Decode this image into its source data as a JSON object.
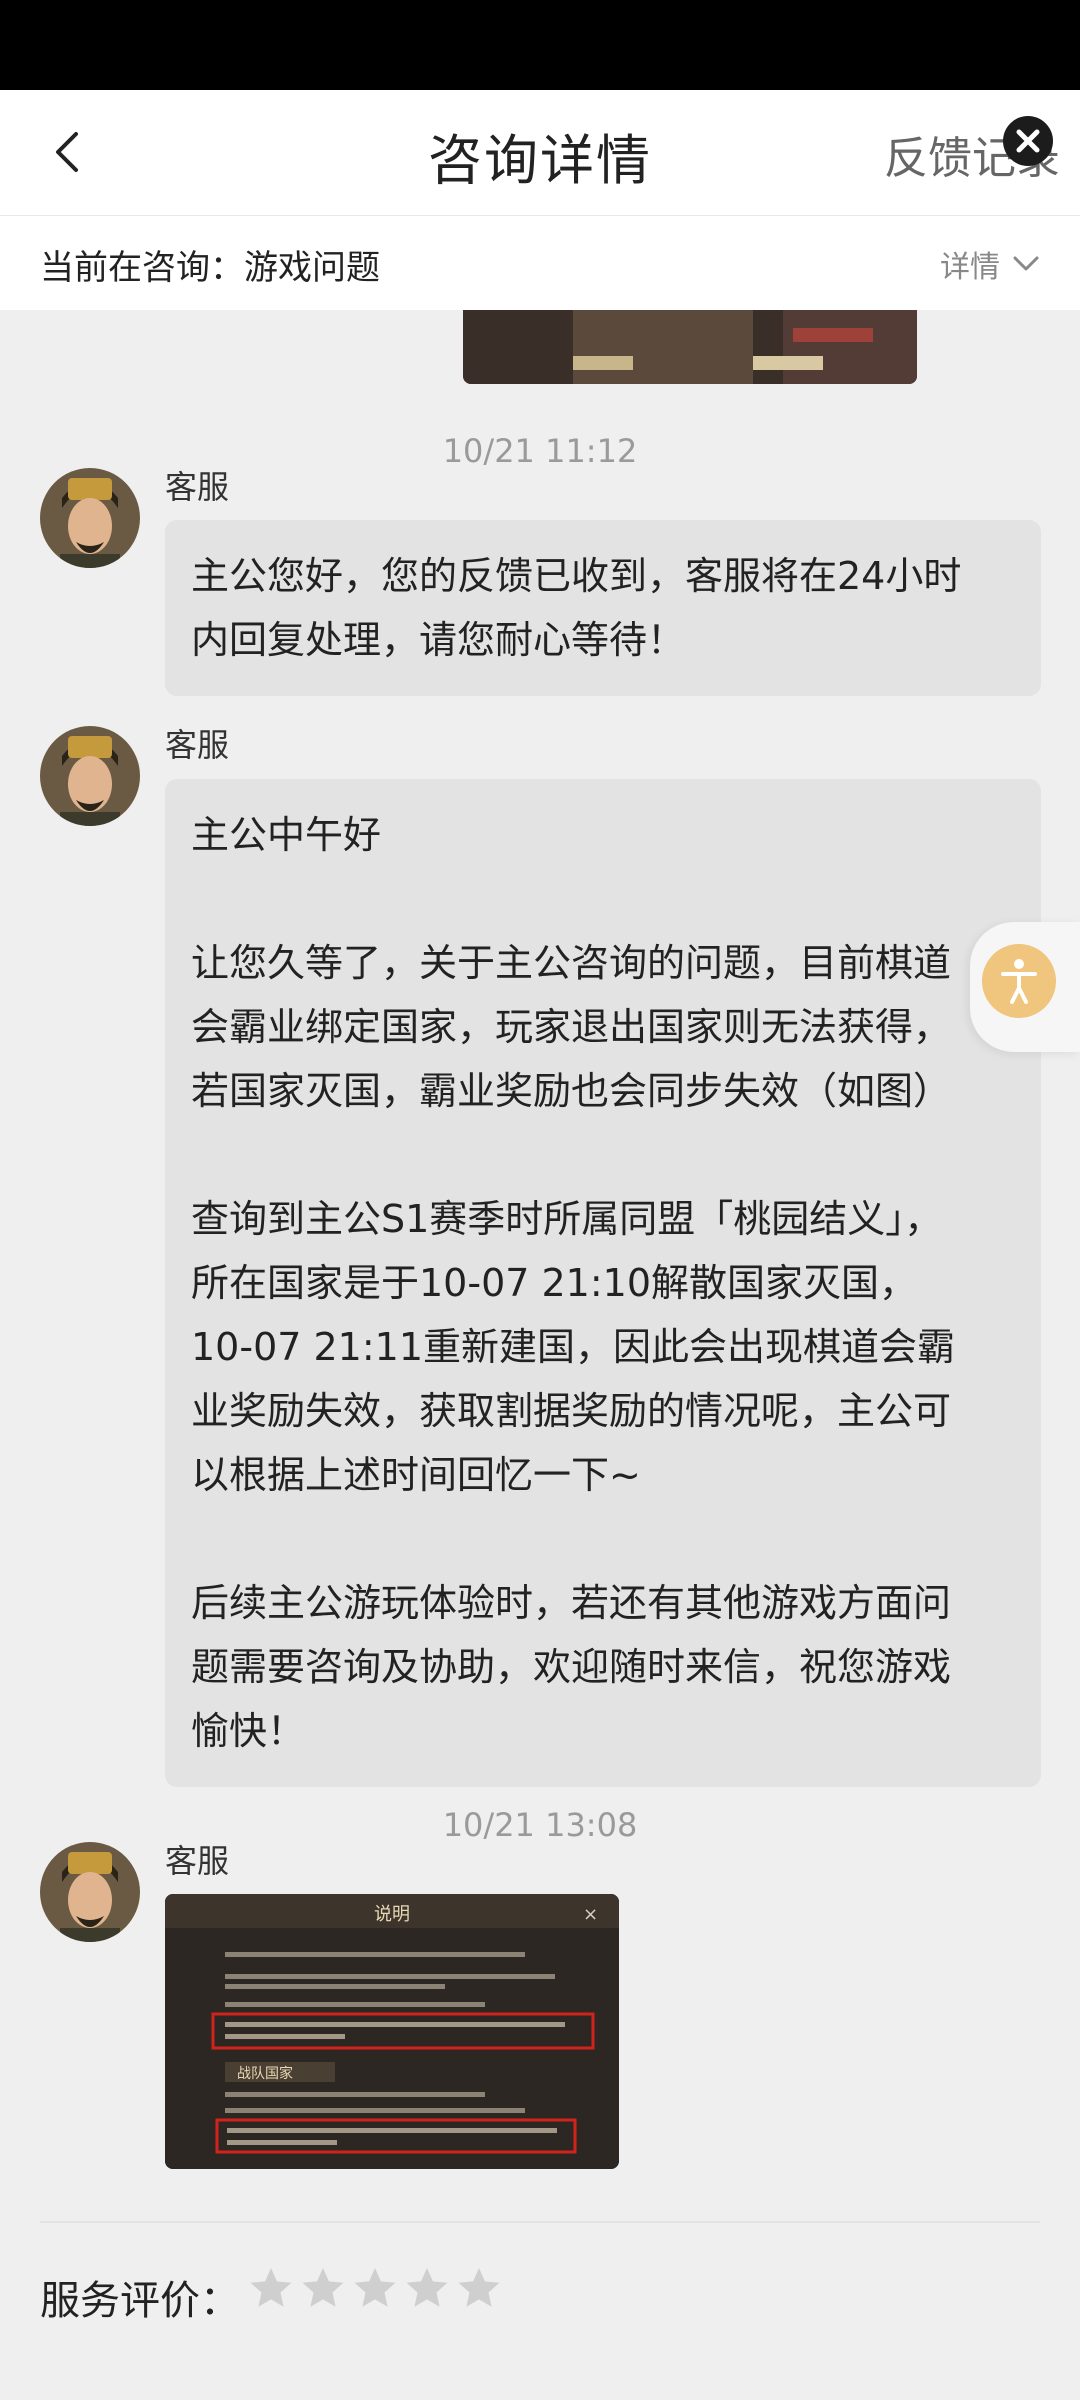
{
  "header": {
    "title": "咨询详情",
    "feedback_link": "反馈记录"
  },
  "topic_bar": {
    "prefix": "当前在咨询：游戏问题",
    "detail_label": "详情"
  },
  "messages": [
    {
      "timestamp": "10/21 11:12",
      "sender": "客服",
      "lines": [
        "主公您好，您的反馈已收到，客服将在24小时",
        "内回复处理，请您耐心等待！"
      ]
    },
    {
      "sender": "客服",
      "lines": [
        "主公中午好",
        "",
        "让您久等了，关于主公咨询的问题，目前棋道",
        "会霸业绑定国家，玩家退出国家则无法获得，",
        "若国家灭国，霸业奖励也会同步失效（如图）",
        "",
        "查询到主公S1赛季时所属同盟「桃园结义」，",
        "所在国家是于10-07 21:10解散国家灭国，",
        "10-07 21:11重新建国，因此会出现棋道会霸",
        "业奖励失效，获取割据奖励的情况呢，主公可",
        "以根据上述时间回忆一下~",
        "",
        "后续主公游玩体验时，若还有其他游戏方面问",
        "题需要咨询及协助，欢迎随时来信，祝您游戏",
        "愉快！"
      ]
    },
    {
      "timestamp": "10/21 13:08",
      "sender": "客服"
    }
  ],
  "image_message": {
    "title": "说明",
    "section_label": "战队国家"
  },
  "rating": {
    "label": "服务评价：",
    "stars": 5,
    "selected": 0
  },
  "icons": [
    "chevron-left-icon",
    "close-icon",
    "chevron-down-icon",
    "star-icon",
    "accessibility-icon",
    "avatar"
  ],
  "colors": {
    "bubble": "#e3e3e3",
    "accessibility": "#f0c57d",
    "highlight_box": "#d0231c"
  }
}
